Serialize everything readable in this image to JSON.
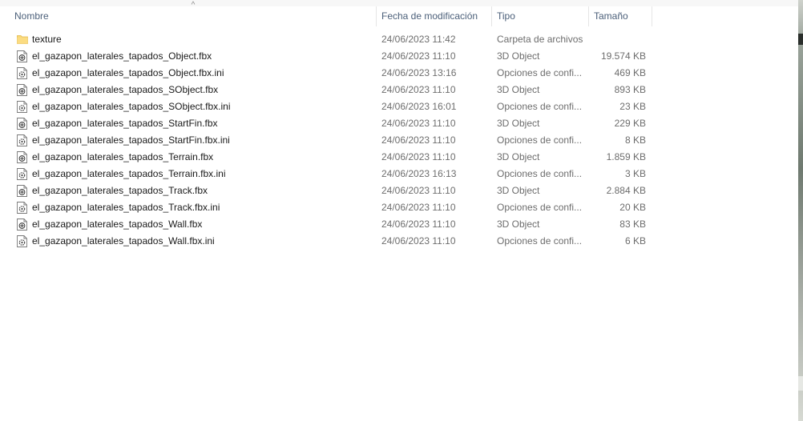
{
  "columns": {
    "name": "Nombre",
    "date": "Fecha de modificación",
    "type": "Tipo",
    "size": "Tamaño"
  },
  "sort": {
    "column": "name",
    "indicator": "^"
  },
  "files": [
    {
      "name": "texture",
      "date": "24/06/2023 11:42",
      "type": "Carpeta de archivos",
      "size": "",
      "icon": "folder-icon"
    },
    {
      "name": "el_gazapon_laterales_tapados_Object.fbx",
      "date": "24/06/2023 11:10",
      "type": "3D Object",
      "size": "19.574 KB",
      "icon": "3d-object-file-icon"
    },
    {
      "name": "el_gazapon_laterales_tapados_Object.fbx.ini",
      "date": "24/06/2023 13:16",
      "type": "Opciones de confi...",
      "size": "469 KB",
      "icon": "settings-file-icon"
    },
    {
      "name": "el_gazapon_laterales_tapados_SObject.fbx",
      "date": "24/06/2023 11:10",
      "type": "3D Object",
      "size": "893 KB",
      "icon": "3d-object-file-icon"
    },
    {
      "name": "el_gazapon_laterales_tapados_SObject.fbx.ini",
      "date": "24/06/2023 16:01",
      "type": "Opciones de confi...",
      "size": "23 KB",
      "icon": "settings-file-icon"
    },
    {
      "name": "el_gazapon_laterales_tapados_StartFin.fbx",
      "date": "24/06/2023 11:10",
      "type": "3D Object",
      "size": "229 KB",
      "icon": "3d-object-file-icon"
    },
    {
      "name": "el_gazapon_laterales_tapados_StartFin.fbx.ini",
      "date": "24/06/2023 11:10",
      "type": "Opciones de confi...",
      "size": "8 KB",
      "icon": "settings-file-icon"
    },
    {
      "name": "el_gazapon_laterales_tapados_Terrain.fbx",
      "date": "24/06/2023 11:10",
      "type": "3D Object",
      "size": "1.859 KB",
      "icon": "3d-object-file-icon"
    },
    {
      "name": "el_gazapon_laterales_tapados_Terrain.fbx.ini",
      "date": "24/06/2023 16:13",
      "type": "Opciones de confi...",
      "size": "3 KB",
      "icon": "settings-file-icon"
    },
    {
      "name": "el_gazapon_laterales_tapados_Track.fbx",
      "date": "24/06/2023 11:10",
      "type": "3D Object",
      "size": "2.884 KB",
      "icon": "3d-object-file-icon"
    },
    {
      "name": "el_gazapon_laterales_tapados_Track.fbx.ini",
      "date": "24/06/2023 11:10",
      "type": "Opciones de confi...",
      "size": "20 KB",
      "icon": "settings-file-icon"
    },
    {
      "name": "el_gazapon_laterales_tapados_Wall.fbx",
      "date": "24/06/2023 11:10",
      "type": "3D Object",
      "size": "83 KB",
      "icon": "3d-object-file-icon"
    },
    {
      "name": "el_gazapon_laterales_tapados_Wall.fbx.ini",
      "date": "24/06/2023 11:10",
      "type": "Opciones de confi...",
      "size": "6 KB",
      "icon": "settings-file-icon"
    }
  ],
  "colors": {
    "header_text": "#4c607a",
    "secondary_text": "#6d6d6d",
    "folder": "#f8d775",
    "hover": "#e5f3ff"
  }
}
